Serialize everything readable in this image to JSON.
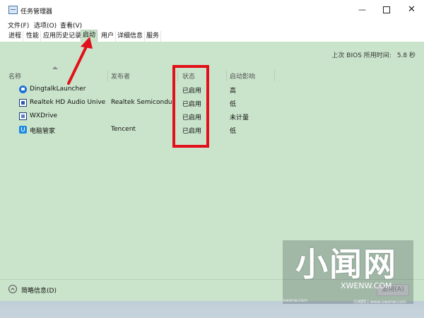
{
  "window": {
    "title": "任务管理器",
    "min": "—",
    "close": "✕"
  },
  "menu": [
    "文件(F)",
    "选项(O)",
    "查看(V)"
  ],
  "tabs": [
    "进程",
    "性能",
    "应用历史记录",
    "启动",
    "用户",
    "详细信息",
    "服务"
  ],
  "active_tab": "启动",
  "bios": {
    "label": "上次 BIOS 所用时间:",
    "value": "5.8 秒"
  },
  "columns": {
    "name": "名称",
    "publisher": "发布者",
    "status": "状态",
    "impact": "启动影响"
  },
  "rows": [
    {
      "icon": "dingtalk-icon",
      "name": "DingtalkLauncher",
      "publisher": "",
      "status": "已启用",
      "impact": "高"
    },
    {
      "icon": "realtek-icon",
      "name": "Realtek HD Audio Univers...",
      "publisher": "Realtek Semiconductor",
      "status": "已启用",
      "impact": "低"
    },
    {
      "icon": "wxdrive-icon",
      "name": "WXDrive",
      "publisher": "",
      "status": "已启用",
      "impact": "未计量"
    },
    {
      "icon": "pc-manager-icon",
      "name": "电脑管家",
      "publisher": "Tencent",
      "status": "已启用",
      "impact": "低"
    }
  ],
  "footer": {
    "brief": "简略信息(D)",
    "disable": "禁用(A)"
  },
  "annotation_color": "#e2101a",
  "watermark": {
    "main": "小闻网",
    "sub": "XWENW.COM",
    "tiny_left": "xwenw.com",
    "tiny_right": "小闻网 | www.xwenw.com"
  }
}
